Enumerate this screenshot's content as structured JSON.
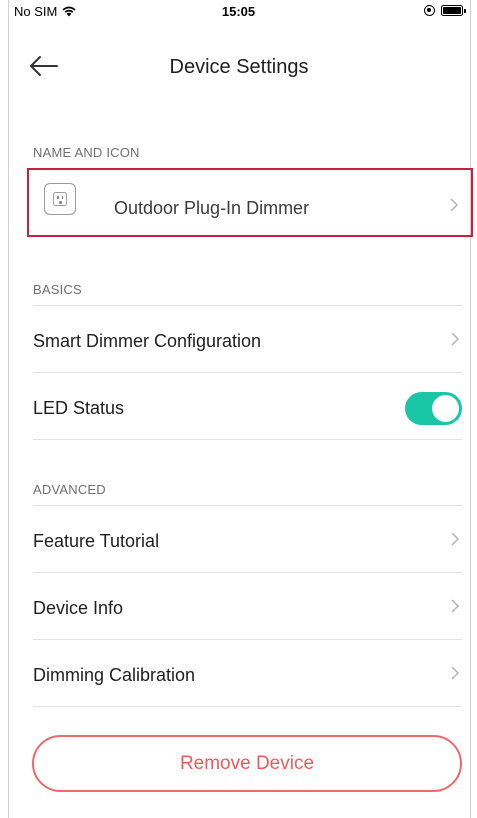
{
  "status_bar": {
    "carrier": "No SIM",
    "time": "15:05",
    "icons": [
      "wifi-icon",
      "orientation-lock-icon",
      "battery-icon"
    ]
  },
  "nav": {
    "back_icon": "arrow-left-icon",
    "title": "Device Settings"
  },
  "name_and_icon": {
    "header": "NAME AND ICON",
    "device_name": "Outdoor Plug-In Dimmer",
    "device_icon": "outlet-plug-icon"
  },
  "basics": {
    "header": "BASICS",
    "items": [
      {
        "label": "Smart Dimmer Configuration"
      },
      {
        "label": "LED Status",
        "toggle_on": true
      }
    ]
  },
  "advanced": {
    "header": "ADVANCED",
    "items": [
      {
        "label": "Feature Tutorial"
      },
      {
        "label": "Device Info"
      },
      {
        "label": "Dimming Calibration"
      }
    ]
  },
  "remove_button": {
    "label": "Remove Device"
  },
  "colors": {
    "accent_toggle": "#19c6a6",
    "highlight_border": "#c8203f",
    "destructive": "#ee5a5a"
  }
}
